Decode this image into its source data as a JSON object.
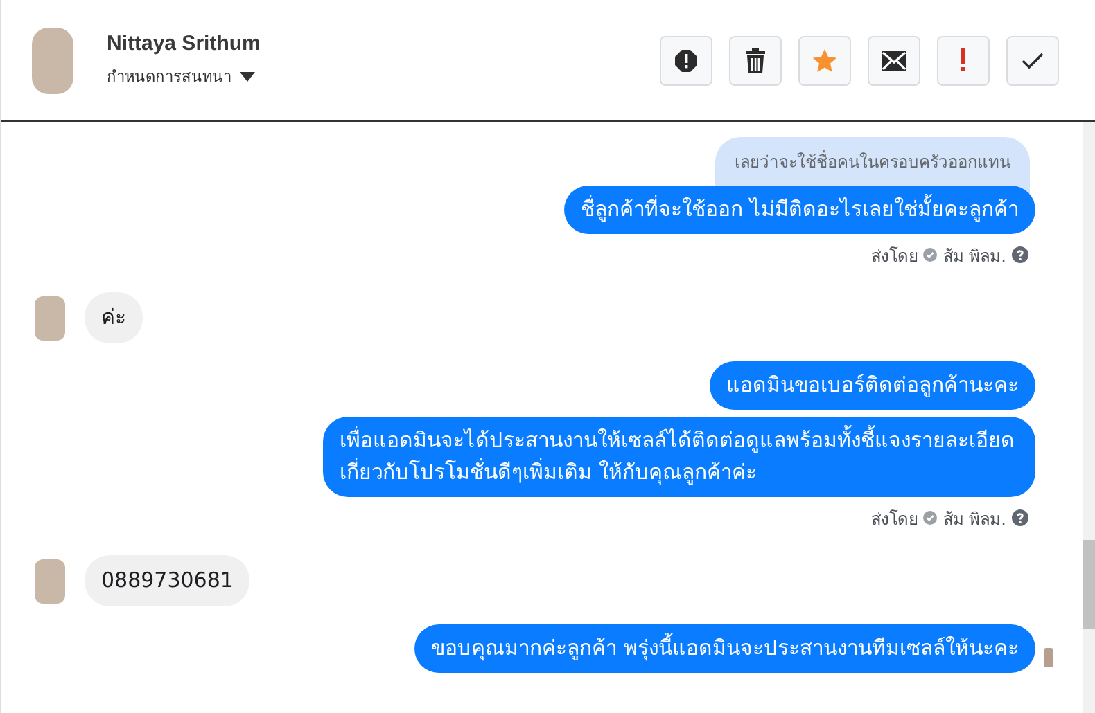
{
  "header": {
    "name": "Nittaya Srithum",
    "subtitle": "กำหนดการสนทนา"
  },
  "actions": [
    {
      "kind": "alert"
    },
    {
      "kind": "trash"
    },
    {
      "kind": "star"
    },
    {
      "kind": "mail"
    },
    {
      "kind": "important"
    },
    {
      "kind": "done"
    }
  ],
  "messages": [
    {
      "kind": "quote",
      "text": "เลยว่าจะใช้ชื่อคนในครอบครัวออกแทน"
    },
    {
      "kind": "out",
      "text": "ชื่ลูกค้าที่จะใช้ออก ไม่มีติดอะไรเลยใช่มั้ยคะลูกค้า",
      "seen": false
    },
    {
      "kind": "meta",
      "label": "ส่งโดย",
      "sender": "ส้ม พิลม."
    },
    {
      "kind": "in",
      "text": "ค่ะ"
    },
    {
      "kind": "out",
      "text": "แอดมินขอเบอร์ติดต่อลูกค้านะคะ",
      "seen": false
    },
    {
      "kind": "out",
      "text": "เพื่อแอดมินจะได้ประสานงานให้เซลล์ได้ติดต่อดูแลพร้อมทั้งชี้แจงรายละเอียด เกี่ยวกับโปรโมชั่นดีๆเพิ่มเติม ให้กับคุณลูกค้าค่ะ",
      "seen": false
    },
    {
      "kind": "meta",
      "label": "ส่งโดย",
      "sender": "ส้ม พิลม."
    },
    {
      "kind": "in",
      "text": "0889730681"
    },
    {
      "kind": "out",
      "text": "ขอบคุณมากค่ะลูกค้า พรุ่งนี้แอดมินจะประสานงานทีมเซลล์ให้นะคะ",
      "seen": true
    }
  ]
}
